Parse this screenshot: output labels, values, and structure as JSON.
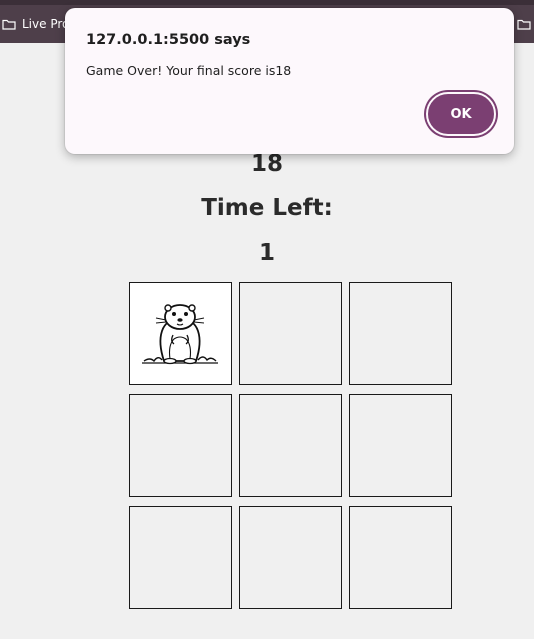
{
  "browser": {
    "bookmarks": [
      {
        "label": "Live Proj",
        "icon": "folder-icon"
      },
      {
        "label": "",
        "icon": "folder-icon"
      },
      {
        "label": "",
        "icon": "folder-icon"
      }
    ]
  },
  "game": {
    "score": "18",
    "time_left_label": "Time Left:",
    "time_left": "1",
    "grid": {
      "rows": 3,
      "cols": 3,
      "mole_cell": 0,
      "mole_icon": "groundhog-icon"
    }
  },
  "dialog": {
    "origin": "127.0.0.1:5500 says",
    "message": "Game Over! Your final score is18",
    "ok_label": "OK"
  },
  "colors": {
    "accent": "#7b3f72",
    "bookmark_bar": "#4e3f4a",
    "page_background": "#f0f0f0"
  }
}
